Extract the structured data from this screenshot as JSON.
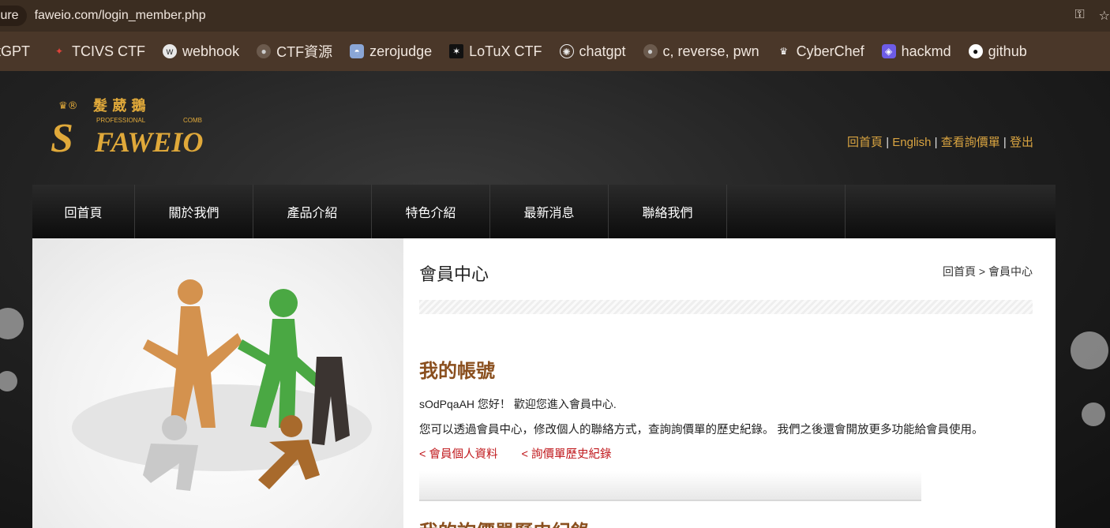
{
  "browser": {
    "secure_chip": "ure",
    "url": "faweio.com/login_member.php",
    "right_icons": [
      "key-icon",
      "star-icon"
    ]
  },
  "bookmarks": [
    {
      "label": "tGPT",
      "icon": ""
    },
    {
      "label": "TCIVS CTF",
      "icon": "flag-icon"
    },
    {
      "label": "webhook",
      "icon": "webhook-icon"
    },
    {
      "label": "CTF資源",
      "icon": "github-icon"
    },
    {
      "label": "zerojudge",
      "icon": "zerojudge-icon"
    },
    {
      "label": "LoTuX CTF",
      "icon": "lotux-icon"
    },
    {
      "label": "chatgpt",
      "icon": "openai-icon"
    },
    {
      "label": "c, reverse, pwn",
      "icon": "github-icon"
    },
    {
      "label": "CyberChef",
      "icon": "chef-hat-icon"
    },
    {
      "label": "hackmd",
      "icon": "hackmd-icon"
    },
    {
      "label": "github",
      "icon": "github-icon"
    }
  ],
  "logo": {
    "brand": "FAWEIO",
    "cn": "髮 葳 鵝",
    "left_small": "PROFESSIONAL",
    "right_small": "COMB"
  },
  "toplinks": {
    "home": "回首頁",
    "english": "English",
    "inquiry": "查看詢價單",
    "logout": "登出",
    "sep": "|"
  },
  "nav": [
    "回首頁",
    "關於我們",
    "產品介紹",
    "特色介紹",
    "最新消息",
    "聯絡我們",
    ""
  ],
  "main": {
    "title": "會員中心",
    "breadcrumb": "回首頁 > 會員中心",
    "section_title": "我的帳號",
    "greeting": "sOdPqaAH 您好！ 歡迎您進入會員中心.",
    "description": "您可以透過會員中心，修改個人的聯絡方式，查詢詢價單的歷史紀錄。 我們之後還會開放更多功能給會員使用。",
    "link_profile": "< 會員個人資料",
    "link_history": "< 詢價單歷史紀錄",
    "next_section_title": "我的詢價單歷史紀錄"
  },
  "colors": {
    "accent_gold": "#d9a441",
    "title_brown": "#8a4f1e",
    "link_red": "#c0181c"
  }
}
